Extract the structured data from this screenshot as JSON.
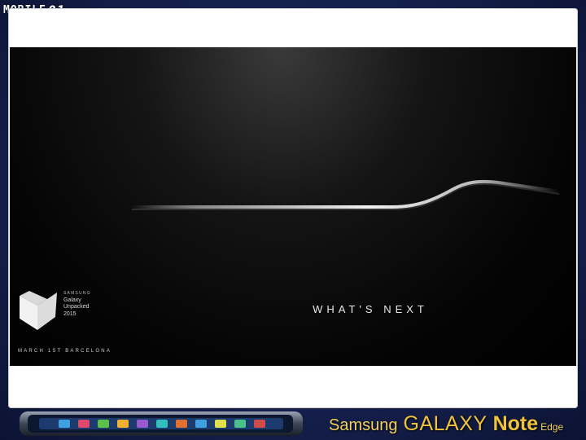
{
  "watermark": {
    "text": "MOBILE",
    "number": "01"
  },
  "teaser": {
    "tagline": "WHAT'S NEXT",
    "event": {
      "brand": "SAMSUNG",
      "name_line1": "Galaxy",
      "name_line2": "Unpacked",
      "year": "2015",
      "date_location": "MARCH 1ST BARCELONA"
    }
  },
  "banner": {
    "brand": "Samsung",
    "model": "GALAXY",
    "variant": "Note",
    "edition": "Edge"
  },
  "colors": {
    "background": "#16214f",
    "banner_text": "#f0c33a",
    "slide": "#ffffff"
  }
}
